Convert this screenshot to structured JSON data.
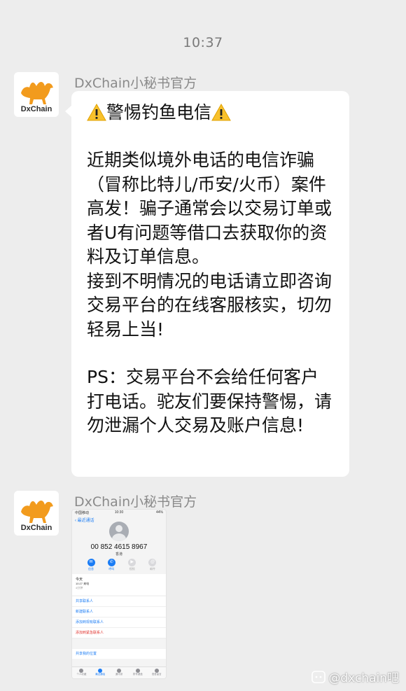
{
  "chat": {
    "timestamp": "10:37",
    "messages": [
      {
        "sender": "DxChain小秘书官方",
        "avatar_text": "DxChain",
        "title": "警惕钓鱼电信",
        "body": [
          "近期类似境外电话的电信诈骗（冒称比特儿/币安/火币）案件高发！骗子通常会以交易订单或者U有问题等借口去获取你的资料及订单信息。",
          "接到不明情况的电话请立即咨询交易平台的在线客服核实，切勿轻易上当!",
          "PS：交易平台不会给任何客户打电话。驼友们要保持警惕，请勿泄漏个人交易及账户信息!"
        ]
      },
      {
        "sender": "DxChain小秘书官方",
        "avatar_text": "DxChain",
        "image": {
          "status_left": "中国移动",
          "status_time": "10:30",
          "status_right": "44%",
          "back_label": "最近通话",
          "phone_number": "00 852 4615 8967",
          "number_sub": "香港",
          "actions": [
            {
              "icon": "message-icon",
              "label": "信息",
              "enabled": true
            },
            {
              "icon": "phone-icon",
              "label": "呼叫",
              "enabled": true
            },
            {
              "icon": "video-icon",
              "label": "视频",
              "enabled": false
            },
            {
              "icon": "mail-icon",
              "label": "邮件",
              "enabled": false
            }
          ],
          "recent_date": "今天",
          "recent_time": "10:27",
          "recent_type": "来电",
          "recent_duration": "4分钟",
          "list_items": [
            "共享联系人",
            "新建联系人",
            "添加到现有联系人",
            "添加到紧急联系人"
          ],
          "share_location": "共享我的位置",
          "tabs": [
            {
              "label": "个人收藏",
              "active": false
            },
            {
              "label": "最近通话",
              "active": true
            },
            {
              "label": "通讯录",
              "active": false
            },
            {
              "label": "拨号键盘",
              "active": false
            },
            {
              "label": "语音留言",
              "active": false
            }
          ]
        }
      }
    ]
  },
  "watermark": {
    "text": "@dxchain吧"
  },
  "colors": {
    "background": "#ededed",
    "bubble": "#ffffff",
    "timestamp": "#7a7a7a",
    "brand_orange": "#f29b1d",
    "link_blue": "#1a7cf5"
  }
}
